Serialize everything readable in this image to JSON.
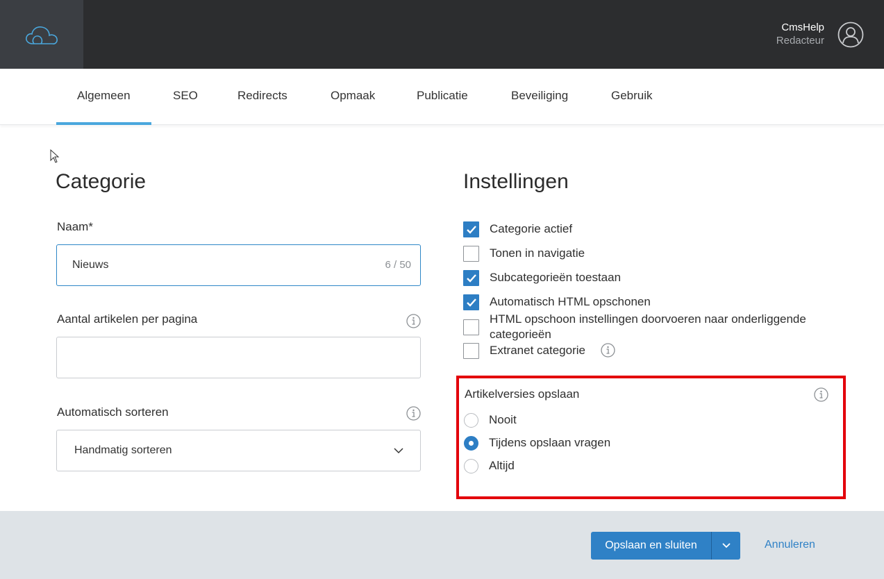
{
  "user": {
    "name": "CmsHelp",
    "role": "Redacteur"
  },
  "tabs": [
    {
      "label": "Algemeen",
      "active": true
    },
    {
      "label": "SEO"
    },
    {
      "label": "Redirects"
    },
    {
      "label": "Opmaak"
    },
    {
      "label": "Publicatie"
    },
    {
      "label": "Beveiliging"
    },
    {
      "label": "Gebruik"
    }
  ],
  "category": {
    "heading": "Categorie",
    "name_label": "Naam*",
    "name_value": "Nieuws",
    "name_counter": "6 / 50",
    "per_page_label": "Aantal artikelen per pagina",
    "per_page_value": "",
    "sort_label": "Automatisch sorteren",
    "sort_value": "Handmatig sorteren"
  },
  "settings": {
    "heading": "Instellingen",
    "checkboxes": [
      {
        "label": "Categorie actief",
        "checked": true
      },
      {
        "label": "Tonen in navigatie",
        "checked": false
      },
      {
        "label": "Subcategorieën toestaan",
        "checked": true
      },
      {
        "label": "Automatisch HTML opschonen",
        "checked": true
      },
      {
        "label": "HTML opschoon instellingen doorvoeren naar onderliggende categorieën",
        "checked": false
      },
      {
        "label": "Extranet categorie",
        "checked": false
      }
    ],
    "versions": {
      "title": "Artikelversies opslaan",
      "options": [
        {
          "label": "Nooit",
          "selected": false
        },
        {
          "label": "Tijdens opslaan vragen",
          "selected": true
        },
        {
          "label": "Altijd",
          "selected": false
        }
      ]
    }
  },
  "footer": {
    "save_label": "Opslaan en sluiten",
    "cancel_label": "Annuleren"
  },
  "colors": {
    "accent": "#2f81c6",
    "tab_indicator": "#4aa7dd",
    "highlight_border": "#e3000b",
    "topbar": "#2c2d2f"
  }
}
